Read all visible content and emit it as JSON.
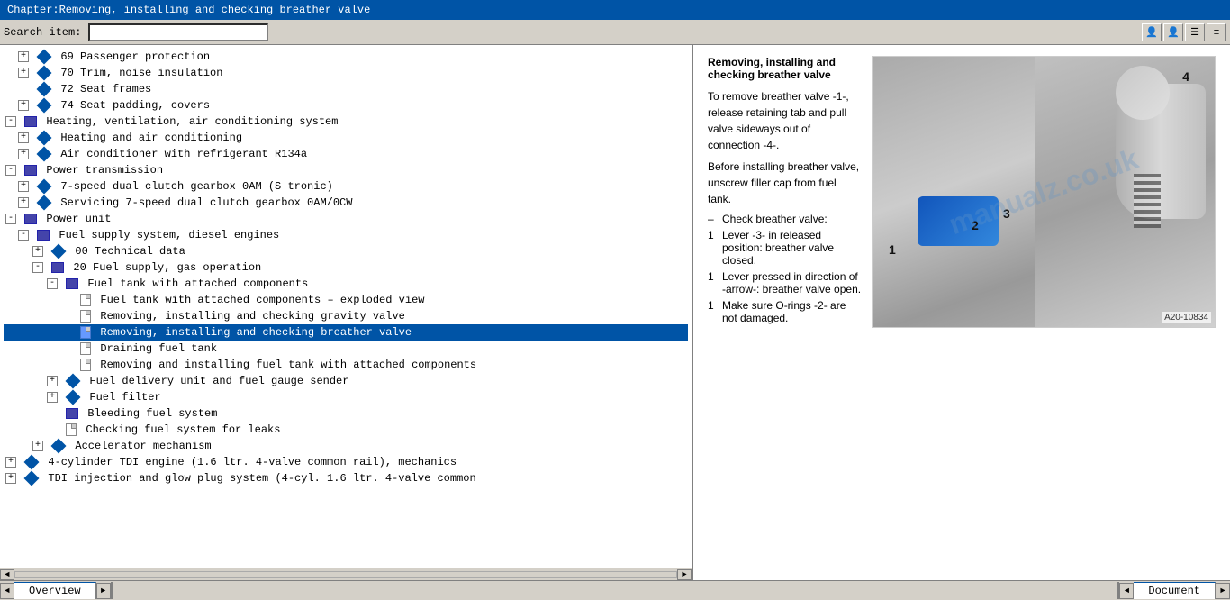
{
  "titleBar": {
    "text": "Chapter:Removing, installing and checking breather valve"
  },
  "toolbar": {
    "searchLabel": "Search item:",
    "searchPlaceholder": "",
    "buttons": [
      "👤",
      "👤",
      "☰",
      "≡"
    ]
  },
  "tree": {
    "items": [
      {
        "indent": 1,
        "icon": "expand+diamond",
        "text": "69 Passenger protection",
        "id": "i69"
      },
      {
        "indent": 1,
        "icon": "expand+diamond",
        "text": "70 Trim, noise insulation",
        "id": "i70"
      },
      {
        "indent": 1,
        "icon": "diamond",
        "text": "72 Seat frames",
        "id": "i72"
      },
      {
        "indent": 1,
        "icon": "expand+diamond",
        "text": "74 Seat padding, covers",
        "id": "i74"
      },
      {
        "indent": 0,
        "icon": "expand+book",
        "text": "Heating, ventilation, air conditioning system",
        "id": "heating"
      },
      {
        "indent": 1,
        "icon": "expand+diamond",
        "text": "Heating and air conditioning",
        "id": "heat1"
      },
      {
        "indent": 1,
        "icon": "expand+diamond",
        "text": "Air conditioner with refrigerant R134a",
        "id": "heat2"
      },
      {
        "indent": 0,
        "icon": "expand+book",
        "text": "Power transmission",
        "id": "powertrans"
      },
      {
        "indent": 1,
        "icon": "expand+diamond",
        "text": "7-speed dual clutch gearbox 0AM (S tronic)",
        "id": "pt1"
      },
      {
        "indent": 1,
        "icon": "expand+diamond",
        "text": "Servicing 7-speed dual clutch gearbox 0AM/0CW",
        "id": "pt2"
      },
      {
        "indent": 0,
        "icon": "expand+book",
        "text": "Power unit",
        "id": "powerunit"
      },
      {
        "indent": 1,
        "icon": "expand+book",
        "text": "Fuel supply system, diesel engines",
        "id": "fuel"
      },
      {
        "indent": 2,
        "icon": "expand+diamond",
        "text": "00 Technical data",
        "id": "f00"
      },
      {
        "indent": 2,
        "icon": "expand+book",
        "text": "20 Fuel supply, gas operation",
        "id": "f20"
      },
      {
        "indent": 3,
        "icon": "expand+book",
        "text": "Fuel tank with attached components",
        "id": "ftank"
      },
      {
        "indent": 4,
        "icon": "doc",
        "text": "Fuel tank with attached components – exploded view",
        "id": "doc1"
      },
      {
        "indent": 4,
        "icon": "doc",
        "text": "Removing, installing and checking gravity valve",
        "id": "doc2"
      },
      {
        "indent": 4,
        "icon": "doc",
        "text": "Removing, installing and checking breather valve",
        "id": "doc3",
        "selected": true
      },
      {
        "indent": 4,
        "icon": "doc",
        "text": "Draining fuel tank",
        "id": "doc4"
      },
      {
        "indent": 4,
        "icon": "doc",
        "text": "Removing and installing fuel tank with attached components",
        "id": "doc5"
      },
      {
        "indent": 3,
        "icon": "expand+diamond",
        "text": "Fuel delivery unit and fuel gauge sender",
        "id": "fdel"
      },
      {
        "indent": 3,
        "icon": "expand+diamond",
        "text": "Fuel filter",
        "id": "ffilt"
      },
      {
        "indent": 3,
        "icon": "book",
        "text": "Bleeding fuel system",
        "id": "fbleed"
      },
      {
        "indent": 3,
        "icon": "doc",
        "text": "Checking fuel system for leaks",
        "id": "fcheck"
      },
      {
        "indent": 2,
        "icon": "expand+diamond",
        "text": "Accelerator mechanism",
        "id": "accel"
      },
      {
        "indent": 0,
        "icon": "expand+diamond",
        "text": "4-cylinder TDI engine (1.6 ltr. 4-valve common rail), mechanics",
        "id": "tdi"
      },
      {
        "indent": 0,
        "icon": "expand+diamond",
        "text": "TDI injection and glow plug system (4-cyl. 1.6 ltr. 4-valve common",
        "id": "tdi2"
      }
    ]
  },
  "document": {
    "title": "Removing, installing and checking breather valve",
    "paragraphs": [
      "To remove breather valve -1-, release retaining tab and pull valve sideways out of connection -4-.",
      "Before installing breather valve, unscrew filler cap from fuel tank.",
      "– Check breather valve:",
      "Lever -3- in released position: breather valve closed.",
      "Lever pressed in direction of -arrow-: breather valve open.",
      "Make sure O-rings -2- are not damaged."
    ],
    "bulletItems": [
      {
        "prefix": "",
        "text": "To remove breather valve -1-, release retaining tab and pull valve sideways out of connection -4-."
      },
      {
        "prefix": "",
        "text": "Before installing breather valve, unscrew filler cap from fuel tank."
      },
      {
        "prefix": "–",
        "text": "Check breather valve:"
      },
      {
        "prefix": "1",
        "text": "Lever -3- in released position: breather valve closed."
      },
      {
        "prefix": "1",
        "text": "Lever pressed in direction of -arrow-: breather valve open."
      },
      {
        "prefix": "1",
        "text": "Make sure O-rings -2- are not damaged."
      }
    ],
    "imageRef": "A20-10834",
    "labels": [
      "1",
      "2",
      "3",
      "4"
    ]
  },
  "statusBar": {
    "leftTabs": [
      "Overview"
    ],
    "rightTabs": [
      "Document"
    ],
    "navButtons": [
      "◄",
      "►"
    ]
  },
  "watermark": "manualz.co.uk"
}
